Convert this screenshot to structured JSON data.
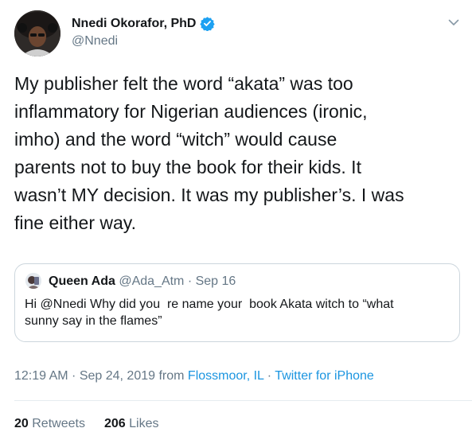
{
  "author": {
    "name": "Nnedi Okorafor, PhD",
    "handle": "@Nnedi",
    "verified": true,
    "avatar": "profile-photo"
  },
  "tweet": {
    "text": "My publisher felt the word “akata” was too\ninflammatory for Nigerian audiences (ironic,\nimho) and the word “witch” would cause\nparents not to buy the book for their kids. It\nwasn’t MY decision. It was my publisher’s. I was\nfine either way."
  },
  "quoted_tweet": {
    "name": "Queen Ada",
    "handle": "@Ada_Atm",
    "separator": " · ",
    "date": "Sep 16",
    "text": "Hi @Nnedi Why did you  re name your  book Akata witch to “what\nsunny say in the flames”"
  },
  "meta": {
    "time": "12:19 AM",
    "dot1": " · ",
    "date": "Sep 24, 2019",
    "from": " from ",
    "location": "Flossmoor, IL",
    "dot2": " · ",
    "source": "Twitter for iPhone"
  },
  "stats": {
    "retweets_count": "20",
    "retweets_label": "Retweets",
    "likes_count": "206",
    "likes_label": "Likes"
  },
  "colors": {
    "text": "#14171a",
    "secondary": "#657786",
    "link": "#1b95e0",
    "verified": "#1da1f2",
    "border": "#ccd6dd"
  },
  "icons": [
    "verified-badge-icon",
    "caret-down-icon"
  ]
}
